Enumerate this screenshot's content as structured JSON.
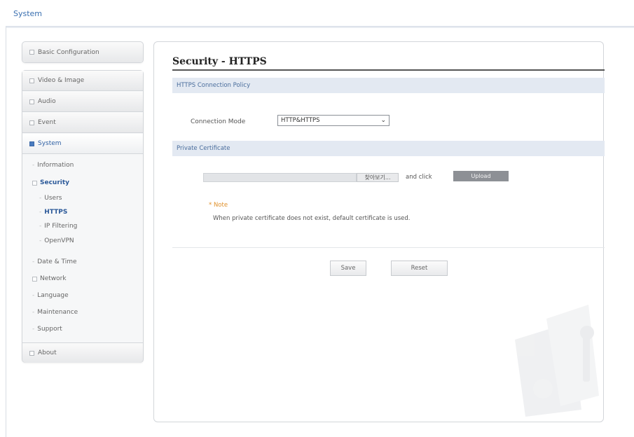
{
  "header": {
    "title": "System"
  },
  "sidebar": {
    "basic_configuration": "Basic Configuration",
    "video_image": "Video & Image",
    "audio": "Audio",
    "event": "Event",
    "system": "System",
    "system_items": {
      "information": "Information",
      "security": "Security",
      "users": "Users",
      "https": "HTTPS",
      "ip_filtering": "IP Filtering",
      "openvpn": "OpenVPN",
      "date_time": "Date & Time",
      "network": "Network",
      "language": "Language",
      "maintenance": "Maintenance",
      "support": "Support"
    },
    "about": "About"
  },
  "main": {
    "title": "Security - HTTPS",
    "section_policy": "HTTPS Connection Policy",
    "connection_mode_label": "Connection Mode",
    "connection_mode_value": "HTTP&HTTPS",
    "section_certificate": "Private Certificate",
    "browse_label": "찾아보기...",
    "and_click": "and click",
    "upload_label": "Upload",
    "note_title": "* Note",
    "note_text": "When private certificate does not exist, default certificate is used.",
    "save_label": "Save",
    "reset_label": "Reset"
  },
  "colors": {
    "accent": "#2d5fa3",
    "section_bar": "#e3e9f2",
    "note": "#e0912c",
    "upload_button": "#8d9095"
  }
}
